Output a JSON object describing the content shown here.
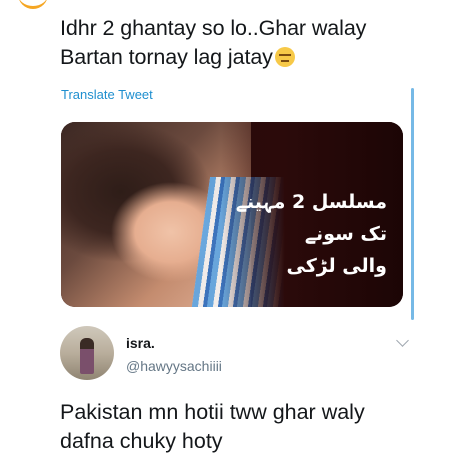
{
  "tweet": {
    "text_line1": "Idhr 2 ghantay so lo..Ghar walay",
    "text_line2": "Bartan tornay lag jatay",
    "emoji": "unamused-face",
    "translate_label": "Translate Tweet"
  },
  "media": {
    "overlay_text_line1": "مسلسل 2 مہینے تک سونے",
    "overlay_text_line2": "والی لڑکی"
  },
  "reply": {
    "display_name": "isra.",
    "handle": "@hawyysachiiii",
    "text_line1": "Pakistan mn hotii tww ghar waly",
    "text_line2": "dafna chuky hoty"
  },
  "colors": {
    "link": "#1f8fcf",
    "handle": "#657786",
    "scroll_indicator": "#76b9e6"
  }
}
